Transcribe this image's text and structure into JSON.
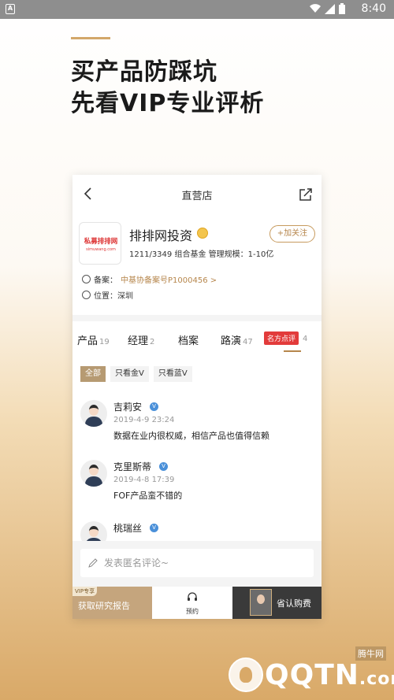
{
  "status": {
    "time": "8:40",
    "app_icon": "A"
  },
  "promo": {
    "line1": "买产品防踩坑",
    "line2": "先看VIP专业评析"
  },
  "topbar": {
    "title": "直营店"
  },
  "company": {
    "logo_brand": "私募排排网",
    "logo_url": "simuwang.com",
    "name": "排排网投资",
    "follow_label": "+加关注",
    "stats": "1211/3349 组合基金 管理规模：1-10亿",
    "record_label": "备案：",
    "record_value": "中基协备案号P1000456 >",
    "location_label": "位置：",
    "location_value": "深圳"
  },
  "tabs": [
    {
      "label": "产品",
      "count": "19"
    },
    {
      "label": "经理",
      "count": "2"
    },
    {
      "label": "档案",
      "count": ""
    },
    {
      "label": "路演",
      "count": "47"
    }
  ],
  "tab_badge": {
    "label": "名方点评",
    "count": "4"
  },
  "filters": [
    "全部",
    "只看金V",
    "只看蓝V"
  ],
  "comments": [
    {
      "name": "吉莉安",
      "date": "2019-4-9 23:24",
      "text": "数据在业内很权威，相信产品也值得信赖"
    },
    {
      "name": "克里斯蒂",
      "date": "2019-4-8 17:39",
      "text": "FOF产品蛮不错的"
    },
    {
      "name": "桃瑞丝",
      "date": "",
      "text": ""
    }
  ],
  "input": {
    "placeholder": "发表匿名评论~"
  },
  "bottom": {
    "vip_tag": "VIP专享",
    "report_label": "获取研究报告",
    "reserve_label": "预约",
    "buy_label": "省认购费"
  },
  "watermark": {
    "text": "QQTN",
    "suffix": ".com",
    "small": "腾牛网"
  },
  "colors": {
    "accent": "#b6864c",
    "badge_red": "#e23b3b",
    "verified_blue": "#4a90d9"
  }
}
